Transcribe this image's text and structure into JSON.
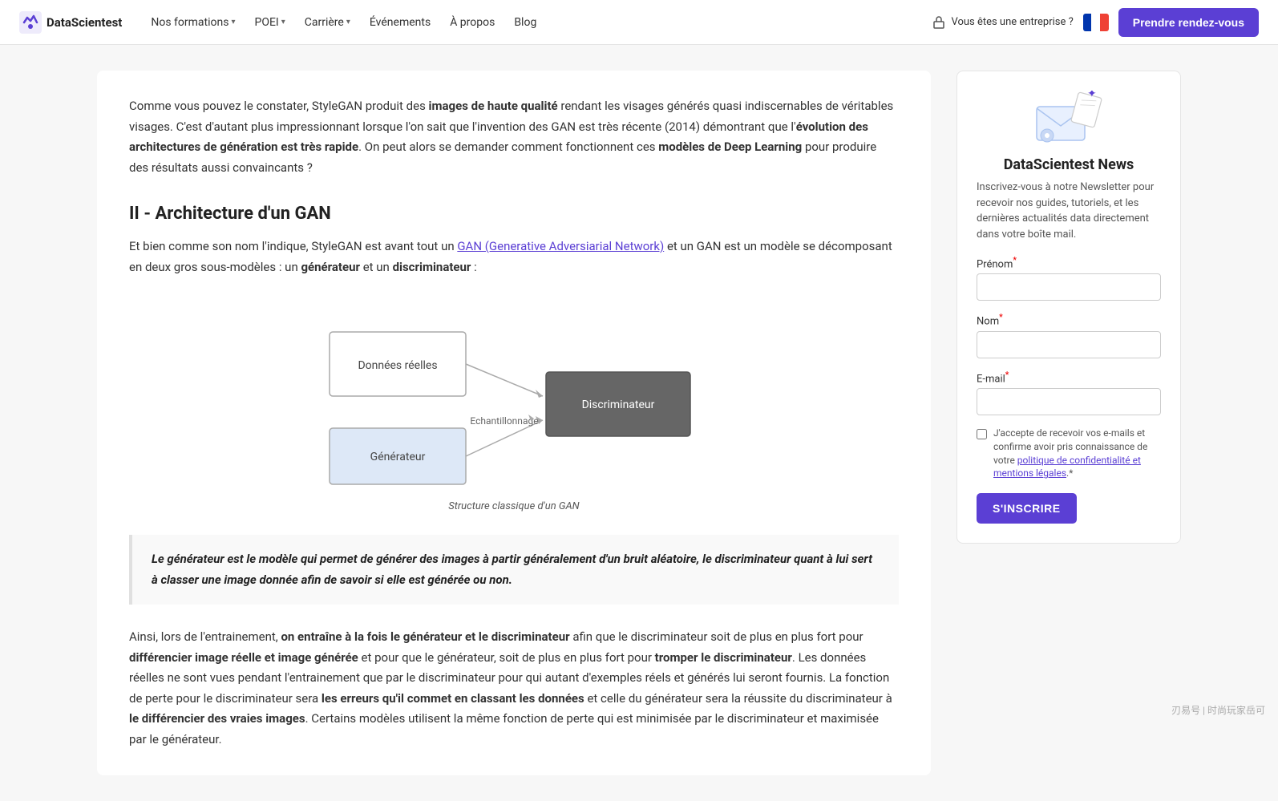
{
  "nav": {
    "logo_text": "DataScientest",
    "links": [
      {
        "label": "Nos formations",
        "has_dropdown": true
      },
      {
        "label": "POEI",
        "has_dropdown": true
      },
      {
        "label": "Carrière",
        "has_dropdown": true
      },
      {
        "label": "Événements",
        "has_dropdown": false
      },
      {
        "label": "À propos",
        "has_dropdown": false
      },
      {
        "label": "Blog",
        "has_dropdown": false
      }
    ],
    "enterprise_label": "Vous êtes une entreprise ?",
    "cta_label": "Prendre rendez-vous"
  },
  "main": {
    "intro_paragraph": "Comme vous pouvez le constater, StyleGAN produit des ",
    "intro_bold1": "images de haute qualité",
    "intro_mid": " rendant les visages générés quasi indiscernables de véritables visages. C'est d'autant plus impressionnant lorsque l'on sait que l'invention des GAN est très récente (2014) démontrant que l'",
    "intro_bold2": "évolution des architectures de génération est très rapide",
    "intro_end": ". On peut alors se demander comment fonctionnent ces ",
    "intro_bold3": "modèles de Deep Learning",
    "intro_end2": " pour produire des résultats aussi convaincants ?",
    "section_heading": "II - Architecture d'un GAN",
    "body1_start": "Et bien comme son nom l'indique, StyleGAN est avant tout un ",
    "body1_link": "GAN (Generative Adversiarial Network)",
    "body1_end": " et un GAN est un modèle se décomposant en deux gros sous-modèles : un ",
    "body1_bold1": "générateur",
    "body1_mid": " et un ",
    "body1_bold2": "discriminateur",
    "body1_end2": " :",
    "diagram_caption": "Structure classique d'un GAN",
    "diagram_labels": {
      "donnees_reelles": "Données réelles",
      "echantillonnage": "Echantillonnage",
      "discriminateur": "Discriminateur",
      "generateur": "Générateur"
    },
    "quote": "Le générateur est le modèle qui permet de générer des images à partir généralement d'un bruit aléatoire, le discriminateur quant à lui sert à classer une image donnée afin de savoir si elle est générée ou non.",
    "closing_start": "Ainsi, lors de l'entrainement, ",
    "closing_bold1": "on entraîne à la fois le générateur et le discriminateur",
    "closing_mid1": " afin que le discriminateur soit de plus en plus fort pour ",
    "closing_bold2": "différencier image réelle et image générée",
    "closing_mid2": " et pour que le générateur, soit de plus en plus fort pour ",
    "closing_bold3": "tromper le discriminateur",
    "closing_mid3": ". Les données réelles ne sont vues pendant l'entrainement que par le discriminateur pour qui autant d'exemples réels et générés lui seront fournis. La fonction de perte pour le discriminateur sera ",
    "closing_bold4": "les erreurs qu'il commet en classant les données",
    "closing_mid4": " et celle du générateur sera la réussite du discriminateur à ",
    "closing_bold5": "le différencier des vraies images",
    "closing_end": ". Certains modèles utilisent la même fonction de perte qui est minimisée par le discriminateur et maximisée par le générateur."
  },
  "sidebar": {
    "title": "DataScientest News",
    "description": "Inscrivez-vous à notre Newsletter pour recevoir nos guides, tutoriels, et les dernières actualités data directement dans votre boîte mail.",
    "fields": {
      "prenom_label": "Prénom",
      "prenom_required": true,
      "nom_label": "Nom",
      "nom_required": true,
      "email_label": "E-mail",
      "email_required": true
    },
    "checkbox_text": "J'accepte de recevoir vos e-mails et confirme avoir pris connaissance de votre politique de confidentialité et mentions légales.",
    "submit_label": "S'INSCRIRE"
  },
  "watermark": "刃易号 | 时尚玩家岳可"
}
